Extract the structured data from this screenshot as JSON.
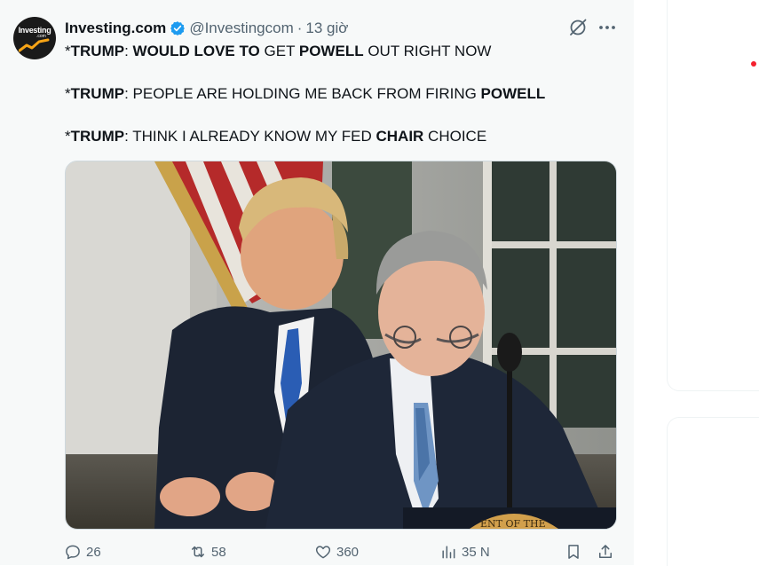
{
  "tweet": {
    "author_name": "Investing.com",
    "handle": "@Investingcom",
    "separator": "·",
    "time": "13 giờ",
    "avatar_logo_text": "Investing",
    "avatar_logo_sub": ".com",
    "lines": [
      [
        {
          "text": "*",
          "bold": false
        },
        {
          "text": "TRUMP",
          "bold": true
        },
        {
          "text": ": ",
          "bold": false
        },
        {
          "text": "WOULD LOVE TO",
          "bold": true
        },
        {
          "text": " GET ",
          "bold": false
        },
        {
          "text": "POWELL",
          "bold": true
        },
        {
          "text": " OUT RIGHT NOW",
          "bold": false
        }
      ],
      [
        {
          "text": "*",
          "bold": false
        },
        {
          "text": "TRUMP",
          "bold": true
        },
        {
          "text": ": PEOPLE ARE HOLDING ME BACK FROM FIRING ",
          "bold": false
        },
        {
          "text": "POWELL",
          "bold": true
        }
      ],
      [
        {
          "text": "*",
          "bold": false
        },
        {
          "text": "TRUMP",
          "bold": true
        },
        {
          "text": ": THINK I ALREADY KNOW MY FED ",
          "bold": false
        },
        {
          "text": "CHAIR",
          "bold": true
        },
        {
          "text": " CHOICE",
          "bold": false
        }
      ]
    ],
    "media": {
      "podium_text": "ENT OF THE"
    },
    "actions": {
      "replies": "26",
      "reposts": "58",
      "likes": "360",
      "views": "35 N"
    }
  },
  "colors": {
    "background": "#f7f9f9",
    "text": "#0f1419",
    "muted": "#536471",
    "verified": "#1d9bf0",
    "notification_dot": "#f4212e"
  },
  "icons": {
    "verified": "verified-badge-icon",
    "grok": "grok-icon",
    "more": "more-horizontal-icon",
    "reply": "reply-icon",
    "repost": "repost-icon",
    "like": "heart-icon",
    "views": "views-icon",
    "bookmark": "bookmark-icon",
    "share": "share-icon"
  }
}
